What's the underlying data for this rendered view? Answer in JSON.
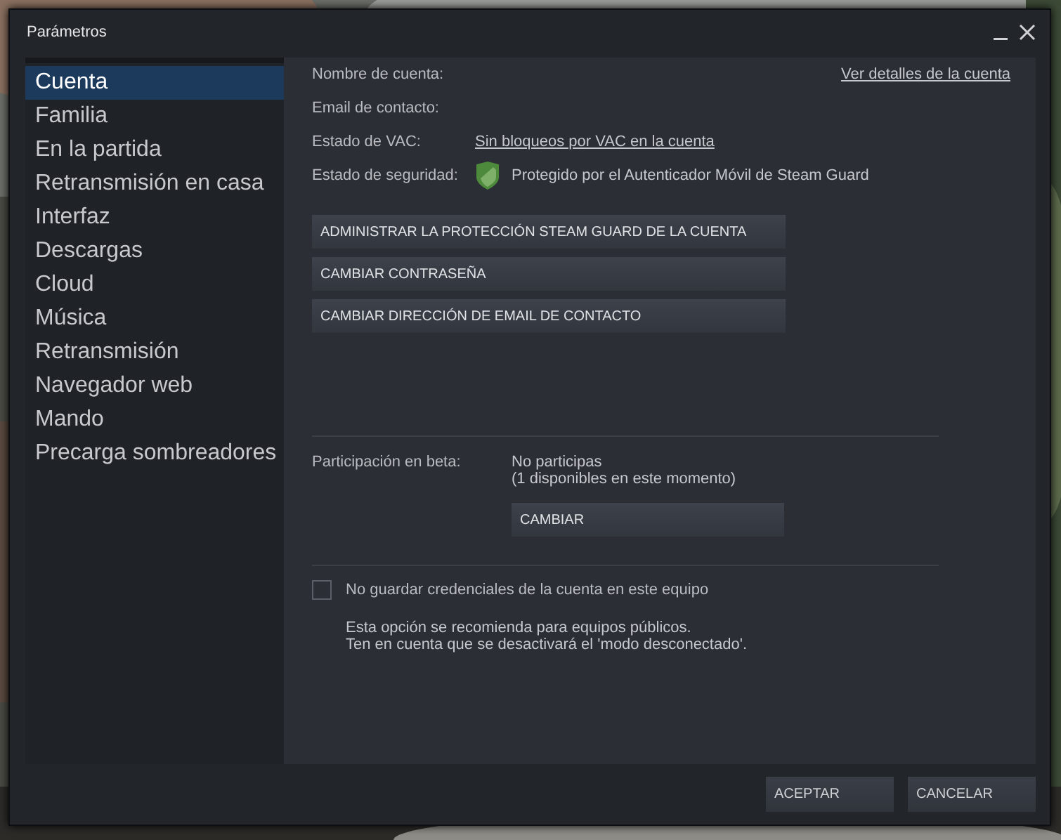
{
  "window": {
    "title": "Parámetros"
  },
  "sidebar": {
    "items": [
      {
        "label": "Cuenta",
        "selected": true
      },
      {
        "label": "Familia",
        "selected": false
      },
      {
        "label": "En la partida",
        "selected": false
      },
      {
        "label": "Retransmisión en casa",
        "selected": false
      },
      {
        "label": "Interfaz",
        "selected": false
      },
      {
        "label": "Descargas",
        "selected": false
      },
      {
        "label": "Cloud",
        "selected": false
      },
      {
        "label": "Música",
        "selected": false
      },
      {
        "label": "Retransmisión",
        "selected": false
      },
      {
        "label": "Navegador web",
        "selected": false
      },
      {
        "label": "Mando",
        "selected": false
      },
      {
        "label": "Precarga sombreadores",
        "selected": false
      }
    ]
  },
  "account": {
    "details_link": "Ver detalles de la cuenta",
    "rows": [
      {
        "label": "Nombre de cuenta:",
        "kind": "empty"
      },
      {
        "label": "Email de contacto:",
        "kind": "empty"
      },
      {
        "label": "Estado de VAC:",
        "kind": "link",
        "value": "Sin bloqueos por VAC en la cuenta"
      },
      {
        "label": "Estado de seguridad:",
        "kind": "shield",
        "value": "Protegido por el Autenticador Móvil de Steam Guard"
      }
    ],
    "buttons": [
      "ADMINISTRAR LA PROTECCIÓN STEAM GUARD DE LA CUENTA",
      "CAMBIAR CONTRASEÑA",
      "CAMBIAR DIRECCIÓN DE EMAIL DE CONTACTO"
    ]
  },
  "beta": {
    "label": "Participación en beta:",
    "status": "No participas",
    "detail": "(1 disponibles en este momento)",
    "button": "CAMBIAR"
  },
  "credentials": {
    "label": "No guardar credenciales de la cuenta en este equipo",
    "checked": false,
    "notes": [
      "Esta opción se recomienda para equipos públicos.",
      "Ten en cuenta que se desactivará el 'modo desconectado'."
    ]
  },
  "footer": {
    "buttons": [
      "ACEPTAR",
      "CANCELAR"
    ]
  }
}
